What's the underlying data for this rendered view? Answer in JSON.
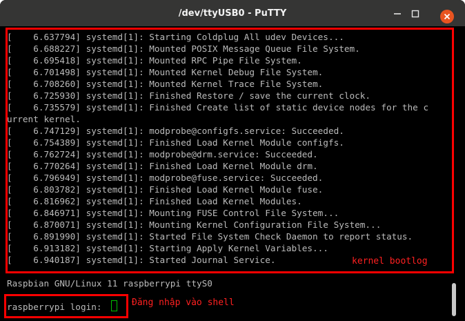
{
  "window": {
    "title": "/dev/ttyUSB0 - PuTTY",
    "controls": [
      "minimize-icon",
      "maximize-icon",
      "close-icon"
    ],
    "close_color": "#e95420"
  },
  "terminal": {
    "lines": [
      "[    6.637794] systemd[1]: Starting Coldplug All udev Devices...",
      "[    6.688227] systemd[1]: Mounted POSIX Message Queue File System.",
      "[    6.695418] systemd[1]: Mounted RPC Pipe File System.",
      "[    6.701498] systemd[1]: Mounted Kernel Debug File System.",
      "[    6.708260] systemd[1]: Mounted Kernel Trace File System.",
      "[    6.725930] systemd[1]: Finished Restore / save the current clock.",
      "[    6.735579] systemd[1]: Finished Create list of static device nodes for the c",
      "urrent kernel.",
      "[    6.747129] systemd[1]: modprobe@configfs.service: Succeeded.",
      "[    6.754389] systemd[1]: Finished Load Kernel Module configfs.",
      "[    6.762724] systemd[1]: modprobe@drm.service: Succeeded.",
      "[    6.770264] systemd[1]: Finished Load Kernel Module drm.",
      "[    6.796949] systemd[1]: modprobe@fuse.service: Succeeded.",
      "[    6.803782] systemd[1]: Finished Load Kernel Module fuse.",
      "[    6.816962] systemd[1]: Finished Load Kernel Modules.",
      "[    6.846971] systemd[1]: Mounting FUSE Control File System...",
      "[    6.870071] systemd[1]: Mounting Kernel Configuration File System...",
      "[    6.891990] systemd[1]: Started File System Check Daemon to report status.",
      "[    6.913182] systemd[1]: Starting Apply Kernel Variables...",
      "[    6.940187] systemd[1]: Started Journal Service."
    ],
    "banner": "Raspbian GNU/Linux 11 raspberrypi ttyS0",
    "login_prompt": "raspberrypi login: ",
    "text_color": "#bbbbbb",
    "cursor_color": "#00c000"
  },
  "annotations": {
    "bootlog_label": "kernel bootlog",
    "login_label": "Đăng nhập vào shell",
    "color": "#ff0000"
  }
}
